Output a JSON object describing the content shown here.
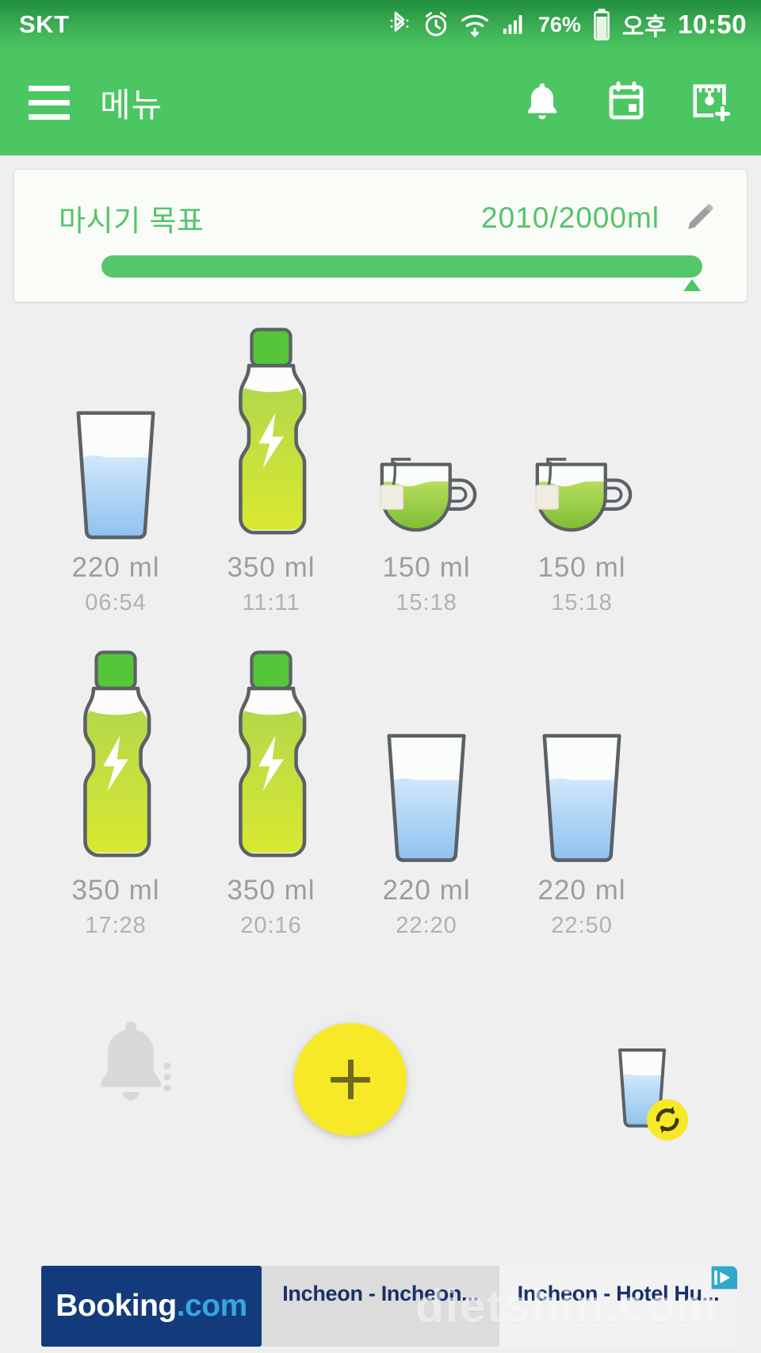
{
  "status_bar": {
    "carrier": "SKT",
    "battery_percent": "76%",
    "am_pm": "오후",
    "time": "10:50",
    "icons": [
      "bluetooth-icon",
      "alarm-icon",
      "wifi-icon",
      "signal-icon",
      "battery-icon"
    ]
  },
  "app_bar": {
    "menu_icon": "hamburger-menu-icon",
    "title": "메뉴",
    "actions": [
      {
        "icon": "bell-icon",
        "name": "notifications-button"
      },
      {
        "icon": "calendar-icon",
        "name": "calendar-button"
      },
      {
        "icon": "add-drink-icon",
        "name": "add-drink-button"
      }
    ]
  },
  "goal_card": {
    "label": "마시기 목표",
    "amount": "2010/2000ml",
    "edit_icon": "pencil-icon",
    "progress_percent": 100,
    "current_ml": 2010,
    "target_ml": 2000
  },
  "drinks": [
    {
      "type": "glass",
      "amount": "220 ml",
      "time": "06:54"
    },
    {
      "type": "bottle",
      "amount": "350 ml",
      "time": "11:11"
    },
    {
      "type": "teacup",
      "amount": "150 ml",
      "time": "15:18"
    },
    {
      "type": "teacup",
      "amount": "150 ml",
      "time": "15:18"
    },
    {
      "type": "bottle",
      "amount": "350 ml",
      "time": "17:28"
    },
    {
      "type": "bottle",
      "amount": "350 ml",
      "time": "20:16"
    },
    {
      "type": "glass",
      "amount": "220 ml",
      "time": "22:20"
    },
    {
      "type": "glass",
      "amount": "220 ml",
      "time": "22:50"
    }
  ],
  "bottom_bar": {
    "reminder_icon": "bell-reminder-icon",
    "add_button_icon": "plus-icon",
    "quick_add_icon": "glass-refresh-icon"
  },
  "ad": {
    "brand": "Booking",
    "brand_suffix": ".com",
    "listing_1": "Incheon - Incheon...",
    "listing_2": "Incheon - Hotel Hu...",
    "adchoices_icon": "adchoices-icon",
    "watermark": "dietshin.com"
  },
  "colors": {
    "brand_green": "#4cc663",
    "status_green": "#39a950",
    "progress_green": "#53c76a",
    "fab_yellow": "#f7e928",
    "water_blue": "#8dc2ef",
    "drink_green": "#cbe03c",
    "page_bg": "#efefef",
    "ad_navy": "#133b7c"
  }
}
